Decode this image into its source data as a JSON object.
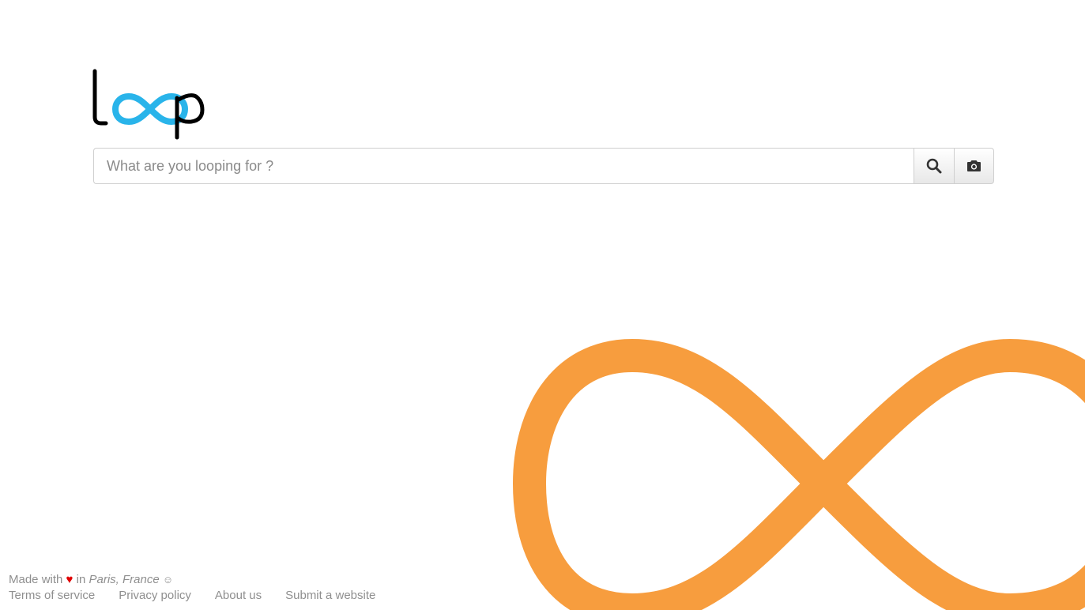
{
  "logo": {
    "text": "loop",
    "colors": {
      "letters": "#000000",
      "infinity": "#29b4ea"
    }
  },
  "search": {
    "placeholder": "What are you looping for ?",
    "value": ""
  },
  "buttons": {
    "search_icon": "search-icon",
    "camera_icon": "camera-icon"
  },
  "footer": {
    "made_with": "Made with",
    "heart": "♥",
    "in": "in",
    "location": "Paris, France",
    "smile": "☺",
    "links": [
      {
        "label": "Terms of service"
      },
      {
        "label": "Privacy policy"
      },
      {
        "label": "About us"
      },
      {
        "label": "Submit a website"
      }
    ]
  },
  "colors": {
    "accent_orange": "#f79d3e",
    "heart_red": "#e00000",
    "footer_text": "#8f8f8f"
  }
}
